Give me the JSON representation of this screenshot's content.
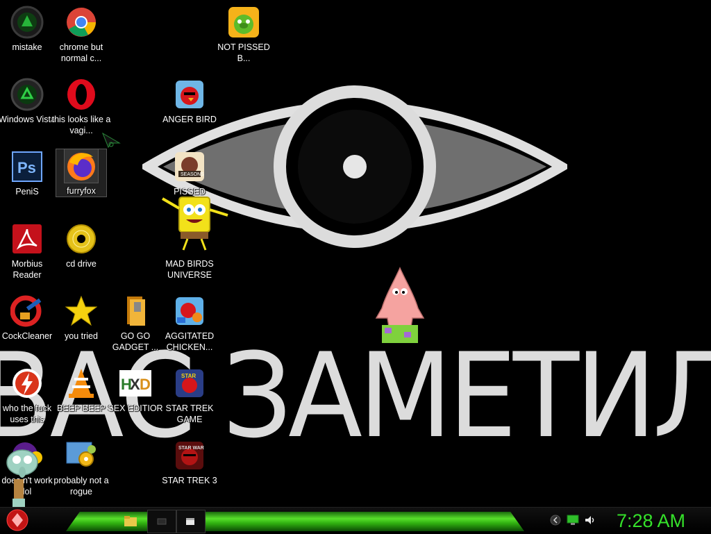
{
  "desktop": {
    "wallpaper_text": "ВАС ЗАМЕТИЛИ",
    "icons": [
      {
        "label": "mistake"
      },
      {
        "label": "chrome but normal c..."
      },
      {
        "label": "NOT PISSED B..."
      },
      {
        "label": "Windows Vista"
      },
      {
        "label": "this looks like a vagi..."
      },
      {
        "label": "ANGER BIRD"
      },
      {
        "label": "PeniS"
      },
      {
        "label": "furryfox"
      },
      {
        "label": "PISSED"
      },
      {
        "label": "Morbius Reader"
      },
      {
        "label": "cd drive"
      },
      {
        "label": "MAD BIRDS UNIVERSE"
      },
      {
        "label": "CockCleaner"
      },
      {
        "label": "you tried"
      },
      {
        "label": "GO GO GADGET ..."
      },
      {
        "label": "AGGITATED CHICKEN..."
      },
      {
        "label": "who the fuck uses this"
      },
      {
        "label": "BEEP BEEP"
      },
      {
        "label": "SEX EDITIOR"
      },
      {
        "label": "STAR TREK GAME"
      },
      {
        "label": "does n't work lol"
      },
      {
        "label": "probably not a rogue"
      },
      {
        "label": "STAR TREK 3"
      }
    ]
  },
  "taskbar": {
    "clock": "7:28 AM",
    "tray_icons": [
      "back-arrow-icon",
      "network-monitor-icon",
      "speaker-icon"
    ]
  },
  "colors": {
    "clock_green": "#35e12a",
    "taskbar_glow": "#57e02a"
  }
}
